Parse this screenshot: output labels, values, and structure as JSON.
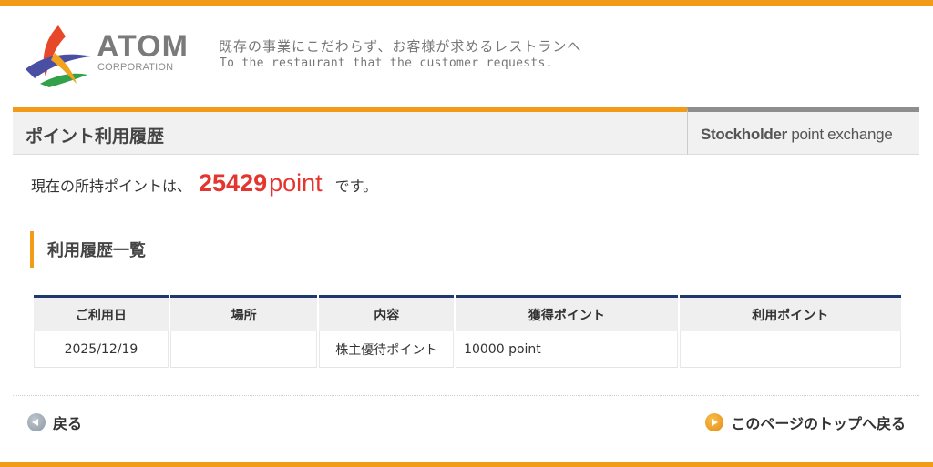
{
  "header": {
    "logo_word": "ATOM",
    "logo_sub": "CORPORATION",
    "tagline_jp": "既存の事業にこだわらず、お客様が求めるレストランへ",
    "tagline_en": "To the restaurant that the customer requests."
  },
  "title_bar": {
    "title": "ポイント利用履歴",
    "right_bold": "Stockholder",
    "right_rest": " point exchange"
  },
  "points": {
    "prefix": "現在の所持ポイントは、",
    "value": "25429",
    "unit": "point",
    "suffix": "です。"
  },
  "section": {
    "heading": "利用履歴一覧"
  },
  "table": {
    "headers": [
      "ご利用日",
      "場所",
      "内容",
      "獲得ポイント",
      "利用ポイント"
    ],
    "rows": [
      [
        "2025/12/19",
        "",
        "株主優待ポイント",
        "10000 point",
        ""
      ]
    ]
  },
  "footer_nav": {
    "back_label": "戻る",
    "top_label": "このページのトップへ戻る"
  },
  "colors": {
    "accent": "#f29b19",
    "points_red": "#e5352f",
    "table_rule": "#1f3a6a"
  }
}
